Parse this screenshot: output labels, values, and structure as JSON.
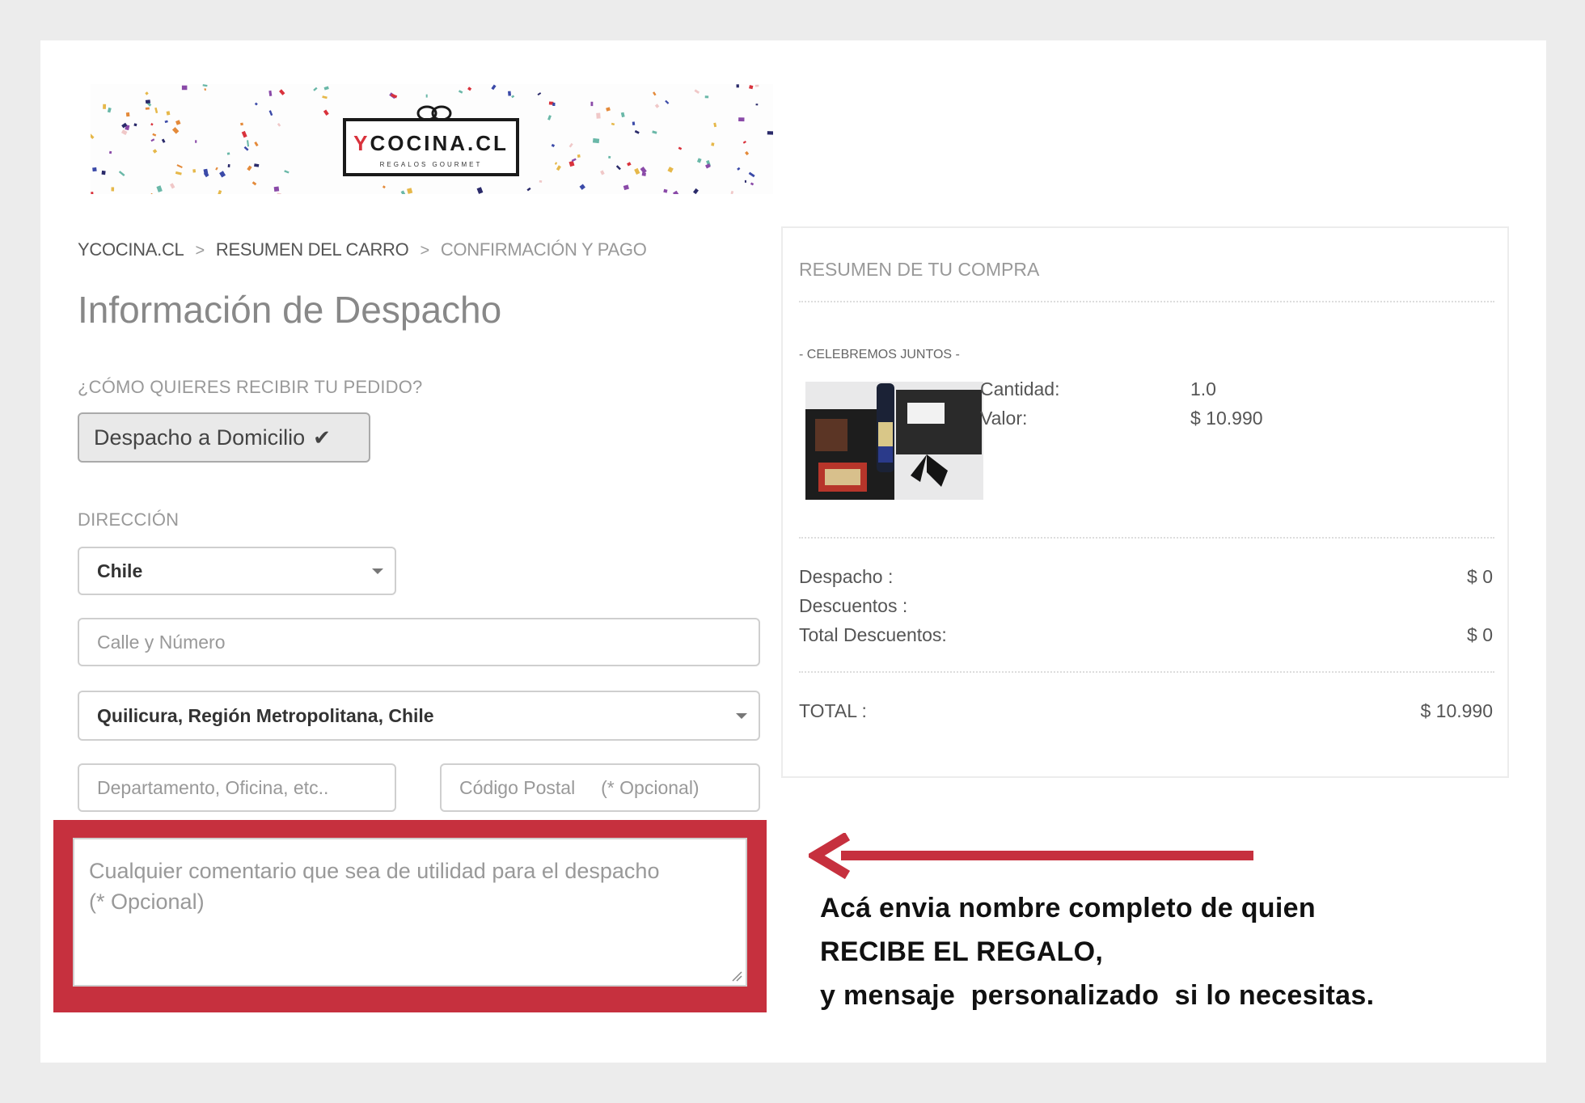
{
  "brand": {
    "name_prefix": "Y",
    "name_rest": "COCINA.CL",
    "tagline": "REGALOS GOURMET"
  },
  "breadcrumb": {
    "items": [
      "YCOCINA.CL",
      "RESUMEN DEL CARRO",
      "CONFIRMACIÓN Y PAGO"
    ],
    "separator": ">"
  },
  "page_title": "Información de Despacho",
  "delivery": {
    "question": "¿CÓMO QUIERES RECIBIR TU PEDIDO?",
    "option_label": "Despacho a Domicilio",
    "option_icon": "checkmark-icon"
  },
  "address": {
    "section_label": "DIRECCIÓN",
    "country_value": "Chile",
    "street_placeholder": "Calle y Número",
    "commune_value": "Quilicura, Región Metropolitana, Chile",
    "apartment_placeholder": "Departamento, Oficina, etc..",
    "postal_placeholder": "Código Postal     (* Opcional)",
    "comment_placeholder_line1": "Cualquier comentario que sea de utilidad para el despacho",
    "comment_placeholder_line2": "(* Opcional)"
  },
  "summary": {
    "title": "RESUMEN DE TU COMPRA",
    "product_name": "- CELEBREMOS JUNTOS -",
    "quantity_label": "Cantidad:",
    "quantity_value": "1.0",
    "price_label": "Valor:",
    "price_value": "$ 10.990",
    "shipping_label": "Despacho :",
    "shipping_value": "$ 0",
    "discounts_label": "Descuentos :",
    "total_discounts_label": "Total Descuentos:",
    "total_discounts_value": "$ 0",
    "total_label": "TOTAL :",
    "total_value": "$ 10.990"
  },
  "annotation": {
    "line1": "Acá envia nombre completo de quien",
    "line2": "RECIBE EL REGALO,",
    "line3": "y mensaje  personalizado  si lo necesitas.",
    "highlight_color": "#c6303e"
  },
  "colors": {
    "accent_red": "#d9323c",
    "annotation_red": "#c6303e"
  }
}
